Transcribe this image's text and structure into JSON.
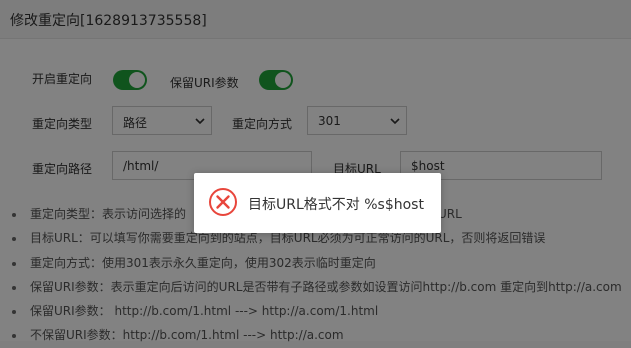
{
  "dialog": {
    "title": "修改重定向[1628913735558]"
  },
  "form": {
    "enable_redirect_label": "开启重定向",
    "keep_uri_label": "保留URI参数",
    "redirect_type_label": "重定向类型",
    "redirect_type_value": "路径",
    "redirect_mode_label": "重定向方式",
    "redirect_mode_value": "301",
    "redirect_path_label": "重定向路径",
    "redirect_path_value": "/html/",
    "target_url_label": "目标URL",
    "target_url_value": "$host"
  },
  "help": {
    "items": [
      "重定向类型：表示访问选择的",
      "目标URL：可以填写你需要重定向到的站点，目标URL必须为可正常访问的URL，否则将返回错误",
      "重定向方式：使用301表示永久重定向，使用302表示临时重定向",
      "保留URI参数：表示重定向后访问的URL是否带有子路径或参数如设置访问http://b.com 重定向到http://a.com",
      "保留URI参数：  http://b.com/1.html ---> http://a.com/1.html",
      "不保留URI参数：http://b.com/1.html ---> http://a.com"
    ],
    "item0_tail": "URL"
  },
  "toast": {
    "message": "目标URL格式不对 %s$host",
    "icon": "error-circle-icon",
    "icon_color": "#e8463c"
  },
  "colors": {
    "toggle_on": "#20a53a",
    "overlay": "rgba(0,0,0,0.49)"
  }
}
